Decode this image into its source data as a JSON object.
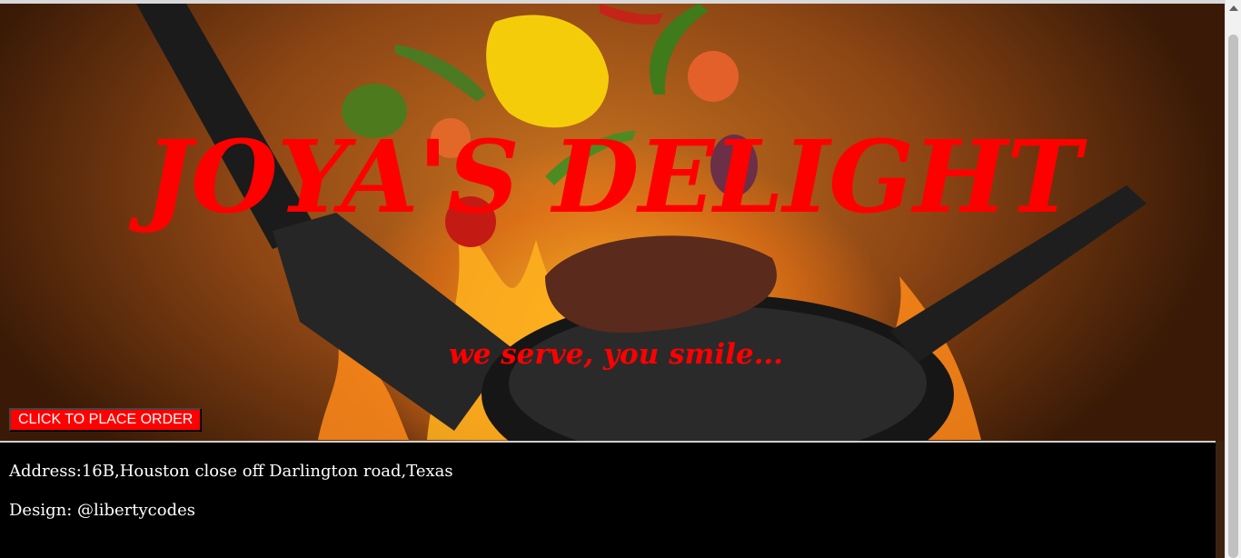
{
  "hero": {
    "title": "JOYA'S DELIGHT",
    "tagline": "we serve, you smile...",
    "order_button": "CLICK TO PLACE ORDER",
    "background_image": "flying-vegetables-steak-pan-flames"
  },
  "footer": {
    "address": "Address:16B,Houston close off Darlington road,Texas",
    "design": "Design: @libertycodes"
  },
  "colors": {
    "accent": "#ff0000",
    "footer_bg": "#000000",
    "footer_text": "#ffffff"
  },
  "icons": {
    "scroll_up": "triangle-up"
  }
}
